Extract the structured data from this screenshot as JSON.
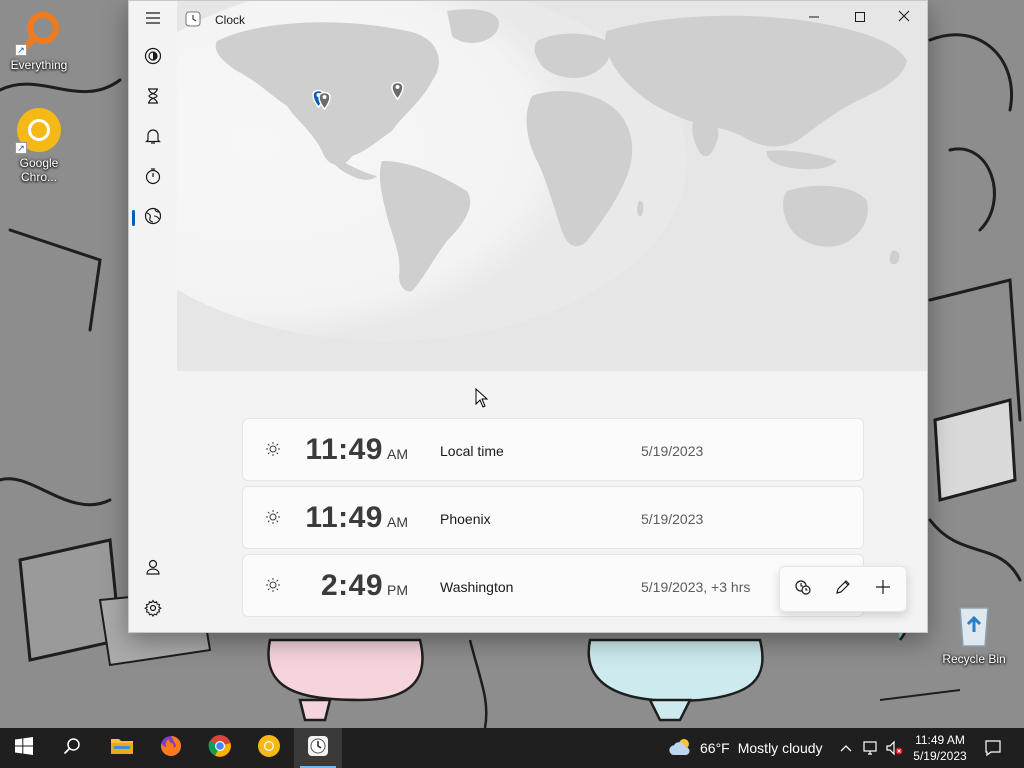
{
  "desktop": {
    "icons": [
      {
        "label": "Everything",
        "icon": "magnifier-icon"
      },
      {
        "label": "Google Chro...",
        "icon": "chrome-canary-icon"
      },
      {
        "label": "Recycle Bin",
        "icon": "recycle-bin-icon"
      }
    ]
  },
  "window": {
    "title": "Clock",
    "caption_buttons": [
      "minimize",
      "maximize",
      "close"
    ]
  },
  "nav": {
    "items": [
      {
        "name": "menu",
        "icon": "hamburger-icon"
      },
      {
        "name": "focus",
        "icon": "focus-sessions-icon"
      },
      {
        "name": "timer",
        "icon": "hourglass-icon"
      },
      {
        "name": "alarm",
        "icon": "bell-icon"
      },
      {
        "name": "stopwatch",
        "icon": "stopwatch-icon"
      },
      {
        "name": "world clock",
        "icon": "globe-icon",
        "active": true
      }
    ],
    "bottom": [
      {
        "name": "account",
        "icon": "person-icon"
      },
      {
        "name": "settings",
        "icon": "gear-icon"
      }
    ]
  },
  "cities": [
    {
      "time": "11:49",
      "ampm": "AM",
      "name": "Local time",
      "date": "5/19/2023"
    },
    {
      "time": "11:49",
      "ampm": "AM",
      "name": "Phoenix",
      "date": "5/19/2023"
    },
    {
      "time": "2:49",
      "ampm": "PM",
      "name": "Washington",
      "date": "5/19/2023, +3 hrs"
    }
  ],
  "fab": {
    "buttons": [
      "compare-icon",
      "edit-icon",
      "add-icon"
    ]
  },
  "taskbar": {
    "apps": [
      "start-icon",
      "search-icon",
      "file-explorer-icon",
      "firefox-icon",
      "chrome-icon",
      "chrome-canary-icon",
      "clock-app-icon"
    ],
    "weather_temp": "66°F",
    "weather_text": "Mostly cloudy",
    "time": "11:49 AM",
    "date": "5/19/2023"
  },
  "colors": {
    "accent": "#005fb8",
    "taskbar": "#1f1f1f"
  }
}
